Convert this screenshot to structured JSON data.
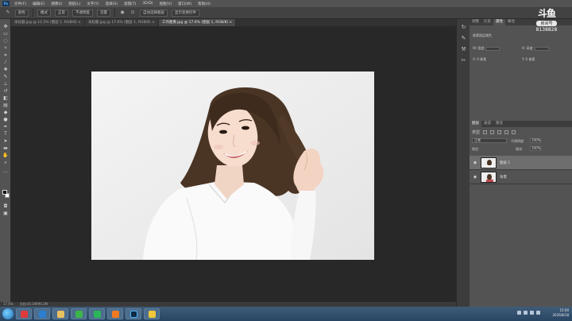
{
  "app": {
    "logo_text": "Ps"
  },
  "menu": [
    "文件(F)",
    "编辑(E)",
    "图像(I)",
    "图层(L)",
    "文字(Y)",
    "选择(S)",
    "滤镜(T)",
    "3D(D)",
    "视图(V)",
    "窗口(W)",
    "帮助(H)"
  ],
  "options_bar": {
    "mode": "颜色",
    "items": [
      "模式",
      "正常",
      "不透明度",
      "流量"
    ],
    "checkbox_label": "自动选择图层",
    "extra": "显示变换控件"
  },
  "document_tabs": [
    {
      "label": "未标题.jpg @ 12.5% (图层 1, RGB/8) ×",
      "active": false
    },
    {
      "label": "未标题.jpg @ 17.6% (图层 1, RGB/8) ×",
      "active": false
    },
    {
      "label": "工作图像.jpg @ 17.6% (图层 1, RGB/8) ×",
      "active": true
    }
  ],
  "status": {
    "zoom": "17.6%",
    "doc": "文档:45.1M/90.2M"
  },
  "right_panel": {
    "top_tabs": [
      "调整",
      "历史",
      "属性",
      "路径"
    ],
    "prop_title": "像素图层属性",
    "prop_rows": [
      "W:  宽度",
      "H:  高度",
      "X:  0 像素",
      "Y:  0 像素"
    ],
    "layers_tabs": [
      "图层",
      "通道",
      "路径"
    ],
    "filter_label": "类型",
    "blend_mode": "正常",
    "opacity_label": "不透明度:",
    "opacity_value": "100%",
    "lock_label": "锁定:",
    "fill_label": "填充:",
    "fill_value": "100%",
    "layers": [
      {
        "name": "图层 1",
        "selected": true
      },
      {
        "name": "背景",
        "selected": false
      }
    ]
  },
  "watermark": {
    "logo": "斗鱼",
    "pill": "房间号",
    "room_id": "8138828"
  },
  "taskbar": {
    "apps": [
      {
        "name": "browser-360",
        "color": "#e03a3a"
      },
      {
        "name": "maxthon",
        "color": "#2a7fd0"
      },
      {
        "name": "folder",
        "color": "#e8c060"
      },
      {
        "name": "wechat",
        "color": "#3cb54a"
      },
      {
        "name": "qq-music",
        "color": "#2bb55a"
      },
      {
        "name": "firefox",
        "color": "#f07a22"
      },
      {
        "name": "photoshop",
        "color": "#0e2a45"
      },
      {
        "name": "paint",
        "color": "#f0c83a"
      }
    ],
    "clock_time": "15:00",
    "clock_date": "2016/8/18"
  },
  "colors": {
    "accent_ps": "#4fb3ff",
    "selected_layer": "#6e6e6e"
  }
}
